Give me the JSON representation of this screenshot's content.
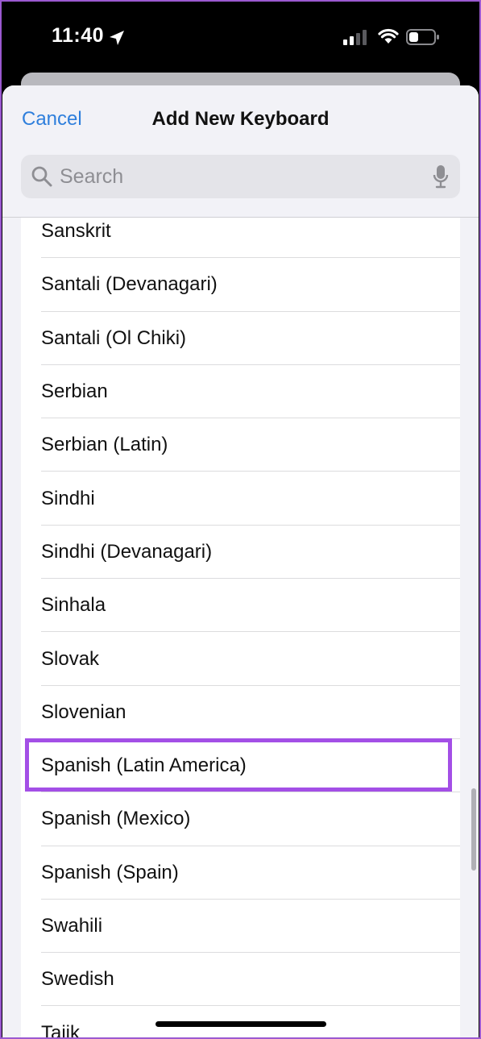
{
  "status_bar": {
    "time": "11:40",
    "location_icon": "location-arrow-icon",
    "signal_icon": "cellular-signal-icon",
    "wifi_icon": "wifi-icon",
    "battery_icon": "battery-icon"
  },
  "nav": {
    "cancel_label": "Cancel",
    "title": "Add New Keyboard"
  },
  "search": {
    "placeholder": "Search",
    "search_icon": "search-icon",
    "mic_icon": "microphone-icon"
  },
  "languages": [
    "Sanskrit",
    "Santali (Devanagari)",
    "Santali (Ol Chiki)",
    "Serbian",
    "Serbian (Latin)",
    "Sindhi",
    "Sindhi (Devanagari)",
    "Sinhala",
    "Slovak",
    "Slovenian",
    "Spanish (Latin America)",
    "Spanish (Mexico)",
    "Spanish (Spain)",
    "Swahili",
    "Swedish",
    "Tajik"
  ],
  "highlighted_item": "Spanish (Latin America)",
  "colors": {
    "accent": "#2f7fdc",
    "highlight": "#a34fe6",
    "frame": "#9b59d0"
  }
}
